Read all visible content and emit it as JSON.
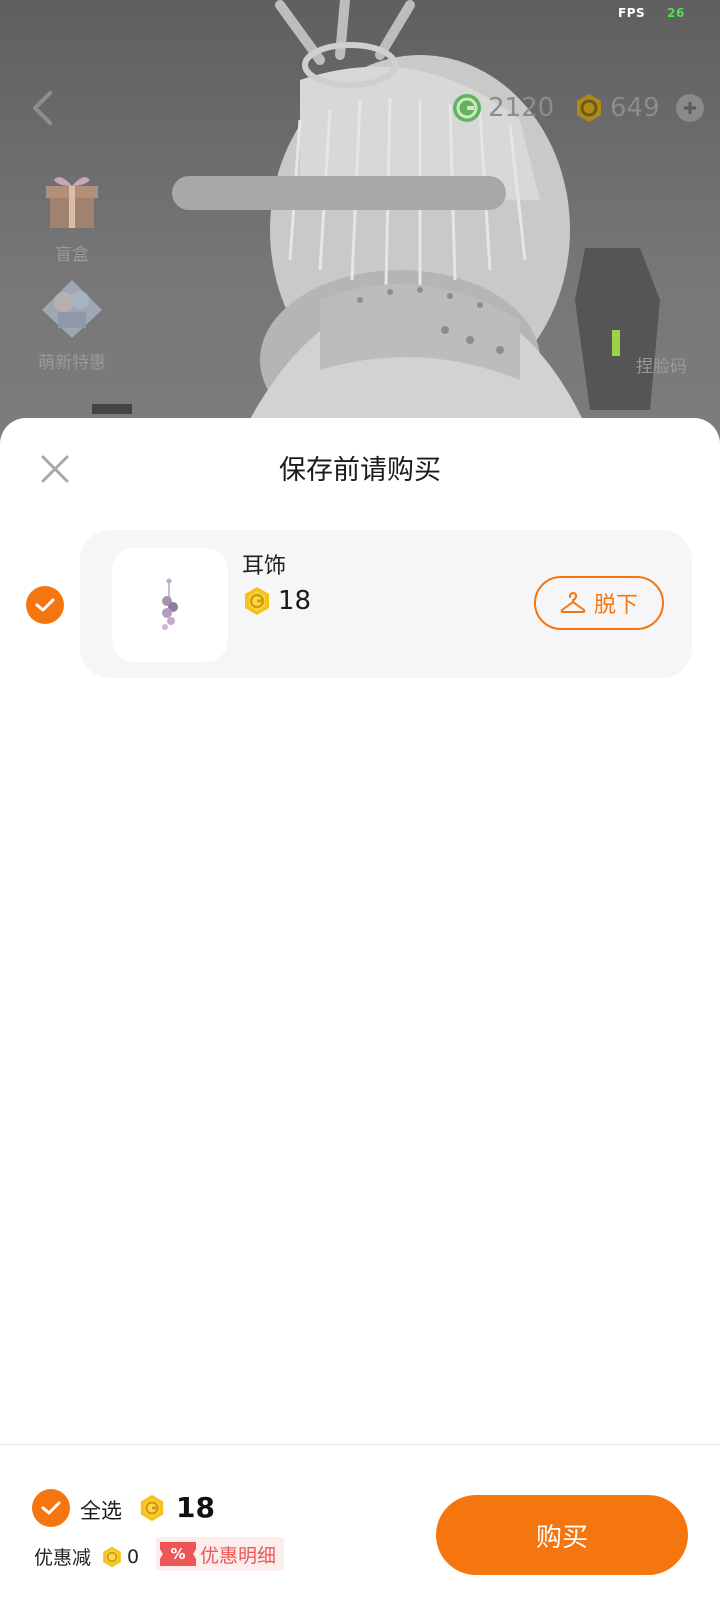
{
  "status": {
    "fps_label": "FPS",
    "fps_value": "26"
  },
  "topbar": {
    "green_currency": {
      "icon": "g-coin-icon",
      "amount": "2120",
      "color": "#3aa63a"
    },
    "gold_currency": {
      "icon": "gold-coin-icon",
      "amount": "649",
      "color": "#f0b400"
    },
    "add_icon": "plus-circle-icon"
  },
  "side_entries": [
    {
      "label": "盲盒",
      "icon": "gift-box-icon"
    },
    {
      "label": "萌新特惠",
      "icon": "newbie-offer-icon"
    }
  ],
  "face_code": {
    "label": "捏脸码"
  },
  "sheet": {
    "title": "保存前请购买",
    "close_icon": "close-icon",
    "items": [
      {
        "name": "耳饰",
        "price": "18",
        "checked": true,
        "remove_label": "脱下",
        "remove_icon": "hanger-icon"
      }
    ]
  },
  "footer": {
    "select_all_label": "全选",
    "total": "18",
    "discount_label": "优惠减",
    "discount_value": "0",
    "discount_tag": "%",
    "discount_detail_label": "优惠明细",
    "buy_label": "购买"
  },
  "colors": {
    "accent": "#f5760f",
    "discount_red": "#f05555"
  }
}
